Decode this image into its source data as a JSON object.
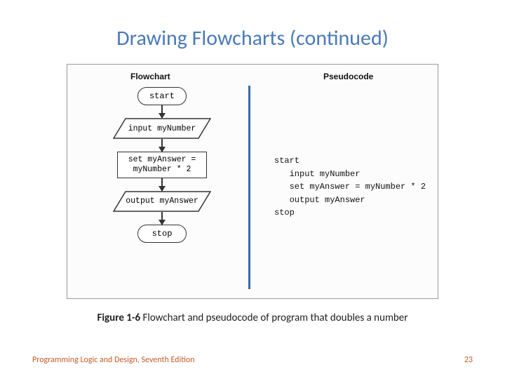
{
  "title": "Drawing Flowcharts (continued)",
  "figure": {
    "headers": {
      "left": "Flowchart",
      "right": "Pseudocode"
    },
    "flow": {
      "start": "start",
      "input": "input myNumber",
      "process_l1": "set myAnswer =",
      "process_l2": "myNumber * 2",
      "output": "output myAnswer",
      "stop": "stop"
    },
    "pseudo": "start\n   input myNumber\n   set myAnswer = myNumber * 2\n   output myAnswer\nstop"
  },
  "caption_label": "Figure 1-6",
  "caption_text": " Flowchart and pseudocode of program that doubles a number",
  "footer_left": "Programming Logic and Design, Seventh Edition",
  "footer_right": "23"
}
